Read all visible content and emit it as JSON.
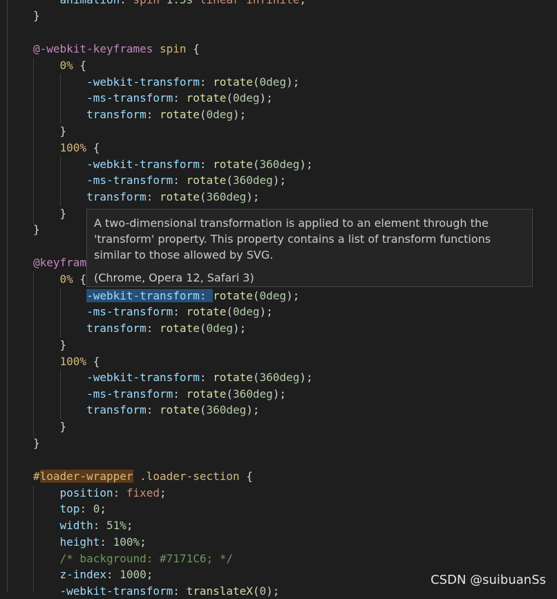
{
  "code": {
    "lines": [
      {
        "parts": [
          [
            "    ",
            "t-p"
          ],
          [
            "animation",
            "t-prop"
          ],
          [
            ": ",
            "t-p"
          ],
          [
            "spin",
            "t-val"
          ],
          [
            " ",
            "t-p"
          ],
          [
            "1.5s",
            "t-num"
          ],
          [
            " ",
            "t-p"
          ],
          [
            "linear",
            "t-val"
          ],
          [
            " ",
            "t-p"
          ],
          [
            "infinite",
            "t-val"
          ],
          [
            ";",
            "t-p"
          ]
        ]
      },
      {
        "parts": [
          [
            "}",
            "t-p"
          ]
        ]
      },
      {
        "parts": []
      },
      {
        "parts": [
          [
            "@-webkit-keyframes",
            "t-at"
          ],
          [
            " ",
            "t-p"
          ],
          [
            "spin",
            "t-kw"
          ],
          [
            " {",
            "t-p"
          ]
        ]
      },
      {
        "parts": [
          [
            "    ",
            "t-p"
          ],
          [
            "0%",
            "t-sel"
          ],
          [
            " {",
            "t-p"
          ]
        ]
      },
      {
        "parts": [
          [
            "        ",
            "t-p"
          ],
          [
            "-webkit-transform",
            "t-prop"
          ],
          [
            ": ",
            "t-p"
          ],
          [
            "rotate",
            "t-fn"
          ],
          [
            "(",
            "t-p"
          ],
          [
            "0",
            "t-num"
          ],
          [
            "deg",
            "t-unit"
          ],
          [
            ");",
            "t-p"
          ]
        ]
      },
      {
        "parts": [
          [
            "        ",
            "t-p"
          ],
          [
            "-ms-transform",
            "t-prop"
          ],
          [
            ": ",
            "t-p"
          ],
          [
            "rotate",
            "t-fn"
          ],
          [
            "(",
            "t-p"
          ],
          [
            "0",
            "t-num"
          ],
          [
            "deg",
            "t-unit"
          ],
          [
            ");",
            "t-p"
          ]
        ]
      },
      {
        "parts": [
          [
            "        ",
            "t-p"
          ],
          [
            "transform",
            "t-prop"
          ],
          [
            ": ",
            "t-p"
          ],
          [
            "rotate",
            "t-fn"
          ],
          [
            "(",
            "t-p"
          ],
          [
            "0",
            "t-num"
          ],
          [
            "deg",
            "t-unit"
          ],
          [
            ");",
            "t-p"
          ]
        ]
      },
      {
        "parts": [
          [
            "    }",
            "t-p"
          ]
        ]
      },
      {
        "parts": [
          [
            "    ",
            "t-p"
          ],
          [
            "100%",
            "t-sel"
          ],
          [
            " {",
            "t-p"
          ]
        ]
      },
      {
        "parts": [
          [
            "        ",
            "t-p"
          ],
          [
            "-webkit-transform",
            "t-prop"
          ],
          [
            ": ",
            "t-p"
          ],
          [
            "rotate",
            "t-fn"
          ],
          [
            "(",
            "t-p"
          ],
          [
            "360",
            "t-num"
          ],
          [
            "deg",
            "t-unit"
          ],
          [
            ");",
            "t-p"
          ]
        ]
      },
      {
        "parts": [
          [
            "        ",
            "t-p"
          ],
          [
            "-ms-transform",
            "t-prop"
          ],
          [
            ": ",
            "t-p"
          ],
          [
            "rotate",
            "t-fn"
          ],
          [
            "(",
            "t-p"
          ],
          [
            "360",
            "t-num"
          ],
          [
            "deg",
            "t-unit"
          ],
          [
            ");",
            "t-p"
          ]
        ]
      },
      {
        "parts": [
          [
            "        ",
            "t-p"
          ],
          [
            "transform",
            "t-prop"
          ],
          [
            ": ",
            "t-p"
          ],
          [
            "rotate",
            "t-fn"
          ],
          [
            "(",
            "t-p"
          ],
          [
            "360",
            "t-num"
          ],
          [
            "deg",
            "t-unit"
          ],
          [
            ");",
            "t-p"
          ]
        ]
      },
      {
        "parts": [
          [
            "    }",
            "t-p"
          ]
        ]
      },
      {
        "parts": [
          [
            "}",
            "t-p"
          ]
        ]
      },
      {
        "parts": []
      },
      {
        "parts": [
          [
            "@keyfram",
            "t-at"
          ]
        ]
      },
      {
        "parts": [
          [
            "    ",
            "t-p"
          ],
          [
            "0%",
            "t-sel"
          ],
          [
            " {",
            "t-p"
          ]
        ]
      },
      {
        "parts": [
          [
            "        ",
            "t-p"
          ],
          [
            "-webkit-transform",
            "t-prop hover-hl"
          ],
          [
            ": ",
            "t-p hover-hl"
          ],
          [
            "rotate",
            "t-fn"
          ],
          [
            "(",
            "t-p"
          ],
          [
            "0",
            "t-num"
          ],
          [
            "deg",
            "t-unit"
          ],
          [
            ");",
            "t-p"
          ]
        ]
      },
      {
        "parts": [
          [
            "        ",
            "t-p"
          ],
          [
            "-ms-transform",
            "t-prop"
          ],
          [
            ": ",
            "t-p"
          ],
          [
            "rotate",
            "t-fn"
          ],
          [
            "(",
            "t-p"
          ],
          [
            "0",
            "t-num"
          ],
          [
            "deg",
            "t-unit"
          ],
          [
            ");",
            "t-p"
          ]
        ]
      },
      {
        "parts": [
          [
            "        ",
            "t-p"
          ],
          [
            "transform",
            "t-prop"
          ],
          [
            ": ",
            "t-p"
          ],
          [
            "rotate",
            "t-fn"
          ],
          [
            "(",
            "t-p"
          ],
          [
            "0",
            "t-num"
          ],
          [
            "deg",
            "t-unit"
          ],
          [
            ");",
            "t-p"
          ]
        ]
      },
      {
        "parts": [
          [
            "    }",
            "t-p"
          ]
        ]
      },
      {
        "parts": [
          [
            "    ",
            "t-p"
          ],
          [
            "100%",
            "t-sel"
          ],
          [
            " {",
            "t-p"
          ]
        ]
      },
      {
        "parts": [
          [
            "        ",
            "t-p"
          ],
          [
            "-webkit-transform",
            "t-prop"
          ],
          [
            ": ",
            "t-p"
          ],
          [
            "rotate",
            "t-fn"
          ],
          [
            "(",
            "t-p"
          ],
          [
            "360",
            "t-num"
          ],
          [
            "deg",
            "t-unit"
          ],
          [
            ");",
            "t-p"
          ]
        ]
      },
      {
        "parts": [
          [
            "        ",
            "t-p"
          ],
          [
            "-ms-transform",
            "t-prop"
          ],
          [
            ": ",
            "t-p"
          ],
          [
            "rotate",
            "t-fn"
          ],
          [
            "(",
            "t-p"
          ],
          [
            "360",
            "t-num"
          ],
          [
            "deg",
            "t-unit"
          ],
          [
            ");",
            "t-p"
          ]
        ]
      },
      {
        "parts": [
          [
            "        ",
            "t-p"
          ],
          [
            "transform",
            "t-prop"
          ],
          [
            ": ",
            "t-p"
          ],
          [
            "rotate",
            "t-fn"
          ],
          [
            "(",
            "t-p"
          ],
          [
            "360",
            "t-num"
          ],
          [
            "deg",
            "t-unit"
          ],
          [
            ");",
            "t-p"
          ]
        ]
      },
      {
        "parts": [
          [
            "    }",
            "t-p"
          ]
        ]
      },
      {
        "parts": [
          [
            "}",
            "t-p"
          ]
        ]
      },
      {
        "parts": []
      },
      {
        "parts": [
          [
            "#",
            "t-sel"
          ],
          [
            "loader-wrapper",
            "t-hlt"
          ],
          [
            " .loader-section",
            "t-sel"
          ],
          [
            " {",
            "t-p"
          ]
        ]
      },
      {
        "parts": [
          [
            "    ",
            "t-p"
          ],
          [
            "position",
            "t-prop"
          ],
          [
            ": ",
            "t-p"
          ],
          [
            "fixed",
            "t-val"
          ],
          [
            ";",
            "t-p"
          ]
        ]
      },
      {
        "parts": [
          [
            "    ",
            "t-p"
          ],
          [
            "top",
            "t-prop"
          ],
          [
            ": ",
            "t-p"
          ],
          [
            "0",
            "t-num"
          ],
          [
            ";",
            "t-p"
          ]
        ]
      },
      {
        "parts": [
          [
            "    ",
            "t-p"
          ],
          [
            "width",
            "t-prop"
          ],
          [
            ": ",
            "t-p"
          ],
          [
            "51%",
            "t-num"
          ],
          [
            ";",
            "t-p"
          ]
        ]
      },
      {
        "parts": [
          [
            "    ",
            "t-p"
          ],
          [
            "height",
            "t-prop"
          ],
          [
            ": ",
            "t-p"
          ],
          [
            "100%",
            "t-num"
          ],
          [
            ";",
            "t-p"
          ]
        ]
      },
      {
        "parts": [
          [
            "    ",
            "t-p"
          ],
          [
            "/* background: #7171C6; */",
            "t-com"
          ]
        ]
      },
      {
        "parts": [
          [
            "    ",
            "t-p"
          ],
          [
            "z-index",
            "t-prop"
          ],
          [
            ": ",
            "t-p"
          ],
          [
            "1000",
            "t-num"
          ],
          [
            ";",
            "t-p"
          ]
        ]
      },
      {
        "parts": [
          [
            "    ",
            "t-p"
          ],
          [
            "-webkit-transform",
            "t-prop"
          ],
          [
            ": ",
            "t-p"
          ],
          [
            "translateX",
            "t-fn"
          ],
          [
            "(",
            "t-p"
          ],
          [
            "0",
            "t-num"
          ],
          [
            ");",
            "t-p"
          ]
        ]
      }
    ]
  },
  "tooltip": {
    "description": "A two-dimensional transformation is applied to an element through the 'transform' property. This property contains a list of transform functions similar to those allowed by SVG.",
    "browsers": "(Chrome, Opera 12, Safari 3)"
  },
  "watermark": "CSDN @suibuanSs"
}
